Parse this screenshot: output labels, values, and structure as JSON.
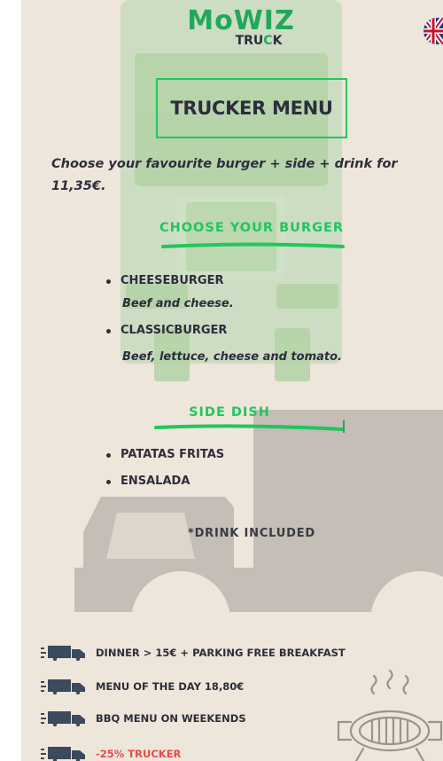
{
  "brand": {
    "logo_main": "MoWIZ",
    "logo_sub_prefix": "TRU",
    "logo_sub_accent": "C",
    "logo_sub_suffix": "K",
    "accent_color": "#22c55e"
  },
  "language": {
    "icon": "uk-flag-icon"
  },
  "menu": {
    "title": "TRUCKER MENU",
    "intro": "Choose your favourite burger + side + drink for 11,35€."
  },
  "burgers": {
    "heading": "CHOOSE YOUR BURGER",
    "items": [
      {
        "name": "CHEESEBURGER",
        "desc": "Beef and cheese."
      },
      {
        "name": "CLASSICBURGER",
        "desc": "Beef, lettuce, cheese and tomato."
      }
    ]
  },
  "sides": {
    "heading": "SIDE DISH",
    "items": [
      {
        "name": "PATATAS FRITAS"
      },
      {
        "name": "ENSALADA"
      }
    ]
  },
  "drink_note": "*DRINK INCLUDED",
  "promos": [
    {
      "text": "DINNER > 15€ + PARKING FREE BREAKFAST",
      "icon": "truck-icon"
    },
    {
      "text": "MENU OF THE DAY 18,80€",
      "icon": "truck-icon"
    },
    {
      "text": "BBQ MENU ON WEEKENDS",
      "icon": "truck-icon"
    },
    {
      "text": "-25% TRUCKER",
      "icon": "truck-icon",
      "highlight": "#e84a4a"
    }
  ],
  "decor": {
    "bbq_icon": "bbq-grill-icon"
  }
}
